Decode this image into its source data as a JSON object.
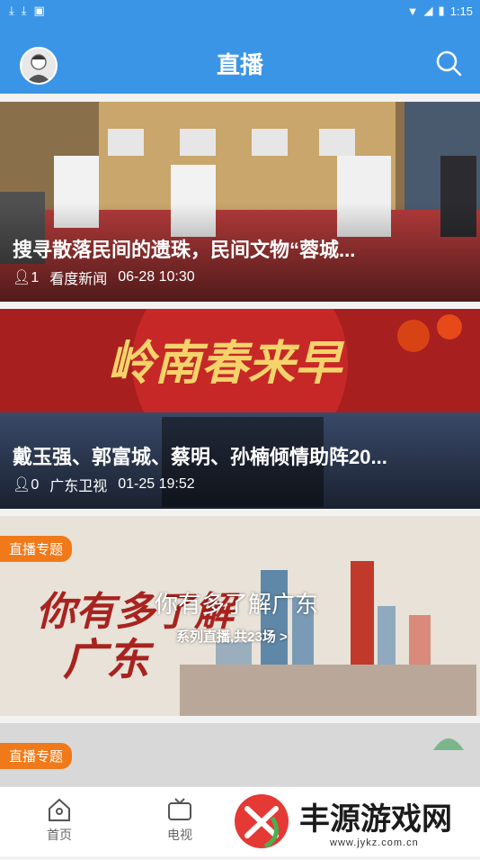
{
  "status": {
    "time": "1:15"
  },
  "header": {
    "title": "直播"
  },
  "cards": [
    {
      "title": "搜寻散落民间的遗珠，民间文物“蓉城...",
      "viewers": "1",
      "source": "看度新闻",
      "time": "06-28 10:30"
    },
    {
      "title": "戴玉强、郭富城、蔡明、孙楠倾情助阵20...",
      "viewers": "0",
      "source": "广东卫视",
      "time": "01-25 19:52",
      "banner_text": "岭南春来早"
    },
    {
      "badge": "直播专题",
      "title": "你有多了解广东",
      "subtitle": "系列直播,共23场 >",
      "art_text_1": "你有多了解",
      "art_text_2": "广东"
    },
    {
      "badge": "直播专题"
    }
  ],
  "tabs": [
    {
      "label": "首页"
    },
    {
      "label": "电视"
    }
  ],
  "watermark": {
    "text": "丰源游戏网",
    "url": "www.jykz.com.cn"
  }
}
